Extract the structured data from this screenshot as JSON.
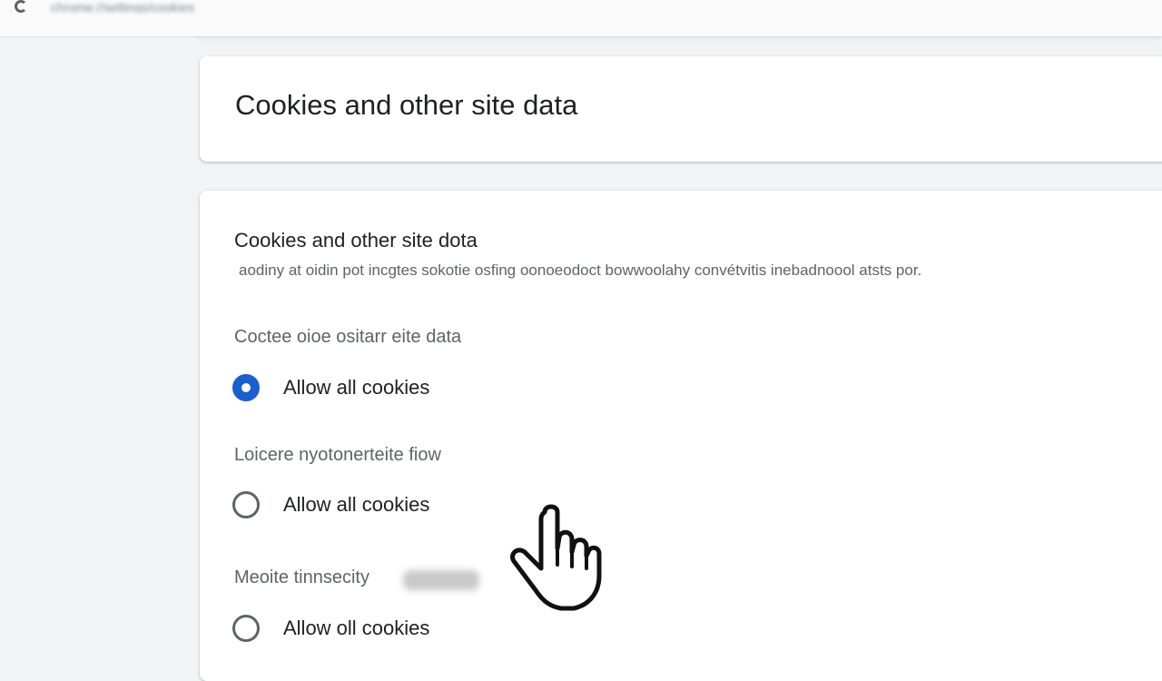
{
  "browser": {
    "address_text": "chrome://settings/cookies"
  },
  "header": {
    "title": "Cookies and other site data"
  },
  "section": {
    "title": "Cookies and other site dota",
    "description": "aodiny at oidin pot incgtes sokotie osfing oonoeodoct bowwoolahy convétvitis inebadnoool atsts por."
  },
  "groups": [
    {
      "label": "Coctee oioe ositarr eite data",
      "option": "Allow all cookies",
      "selected": true
    },
    {
      "label": "Loicere nyotonerteite fiow",
      "option": "Allow all cookies",
      "selected": false
    },
    {
      "label": "Meoite tinnsecity",
      "option": "Allow oll cookies",
      "selected": false
    }
  ],
  "colors": {
    "accent": "#1a5fd0",
    "background": "#f1f3f4",
    "card": "#ffffff"
  },
  "icons": {
    "browser": "chrome-icon",
    "cursor": "hand-pointer-icon",
    "radio_on": "radio-checked-icon",
    "radio_off": "radio-unchecked-icon"
  }
}
